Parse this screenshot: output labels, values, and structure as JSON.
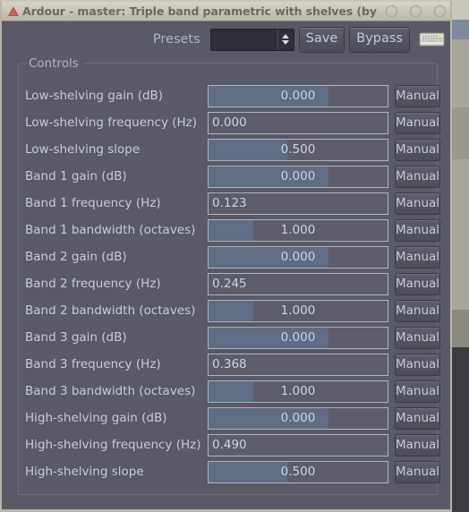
{
  "window": {
    "title": "Ardour - master: Triple band parametric with shelves (by",
    "logo_icon": "ardour-logo-icon",
    "buttons": [
      {
        "name": "minimize-button",
        "icon": "minimize-icon"
      },
      {
        "name": "maximize-button",
        "icon": "maximize-icon"
      },
      {
        "name": "close-button",
        "icon": "close-icon"
      }
    ]
  },
  "toolbar": {
    "presets_label": "Presets",
    "presets_value": "",
    "presets_placeholder": "",
    "spinner_icon": "spinner-up-down-icon",
    "save_label": "Save",
    "bypass_label": "Bypass",
    "midi_learn_icon": "keyboard-icon"
  },
  "controls": {
    "legend": "Controls",
    "manual_label": "Manual",
    "fill_color": "#5f6d85",
    "track_color": "#5d5d69",
    "rows": [
      {
        "label": "Low-shelving gain (dB)",
        "value": "0.000",
        "fill": 67,
        "align": "mid"
      },
      {
        "label": "Low-shelving frequency (Hz)",
        "value": "0.000",
        "fill": 0,
        "align": "left"
      },
      {
        "label": "Low-shelving slope",
        "value": "0.500",
        "fill": 44,
        "align": "mid"
      },
      {
        "label": "Band 1 gain (dB)",
        "value": "0.000",
        "fill": 67,
        "align": "mid"
      },
      {
        "label": "Band 1 frequency (Hz)",
        "value": "0.123",
        "fill": 0,
        "align": "left"
      },
      {
        "label": "Band 1 bandwidth (octaves)",
        "value": "1.000",
        "fill": 25,
        "align": "mid"
      },
      {
        "label": "Band 2 gain (dB)",
        "value": "0.000",
        "fill": 67,
        "align": "mid"
      },
      {
        "label": "Band 2 frequency (Hz)",
        "value": "0.245",
        "fill": 0,
        "align": "left"
      },
      {
        "label": "Band 2 bandwidth (octaves)",
        "value": "1.000",
        "fill": 25,
        "align": "mid"
      },
      {
        "label": "Band 3 gain (dB)",
        "value": "0.000",
        "fill": 67,
        "align": "mid"
      },
      {
        "label": "Band 3 frequency (Hz)",
        "value": "0.368",
        "fill": 0,
        "align": "left"
      },
      {
        "label": "Band 3 bandwidth (octaves)",
        "value": "1.000",
        "fill": 25,
        "align": "mid"
      },
      {
        "label": "High-shelving gain (dB)",
        "value": "0.000",
        "fill": 67,
        "align": "mid"
      },
      {
        "label": "High-shelving frequency (Hz)",
        "value": "0.490",
        "fill": 0,
        "align": "left"
      },
      {
        "label": "High-shelving slope",
        "value": "0.500",
        "fill": 44,
        "align": "mid"
      }
    ]
  }
}
